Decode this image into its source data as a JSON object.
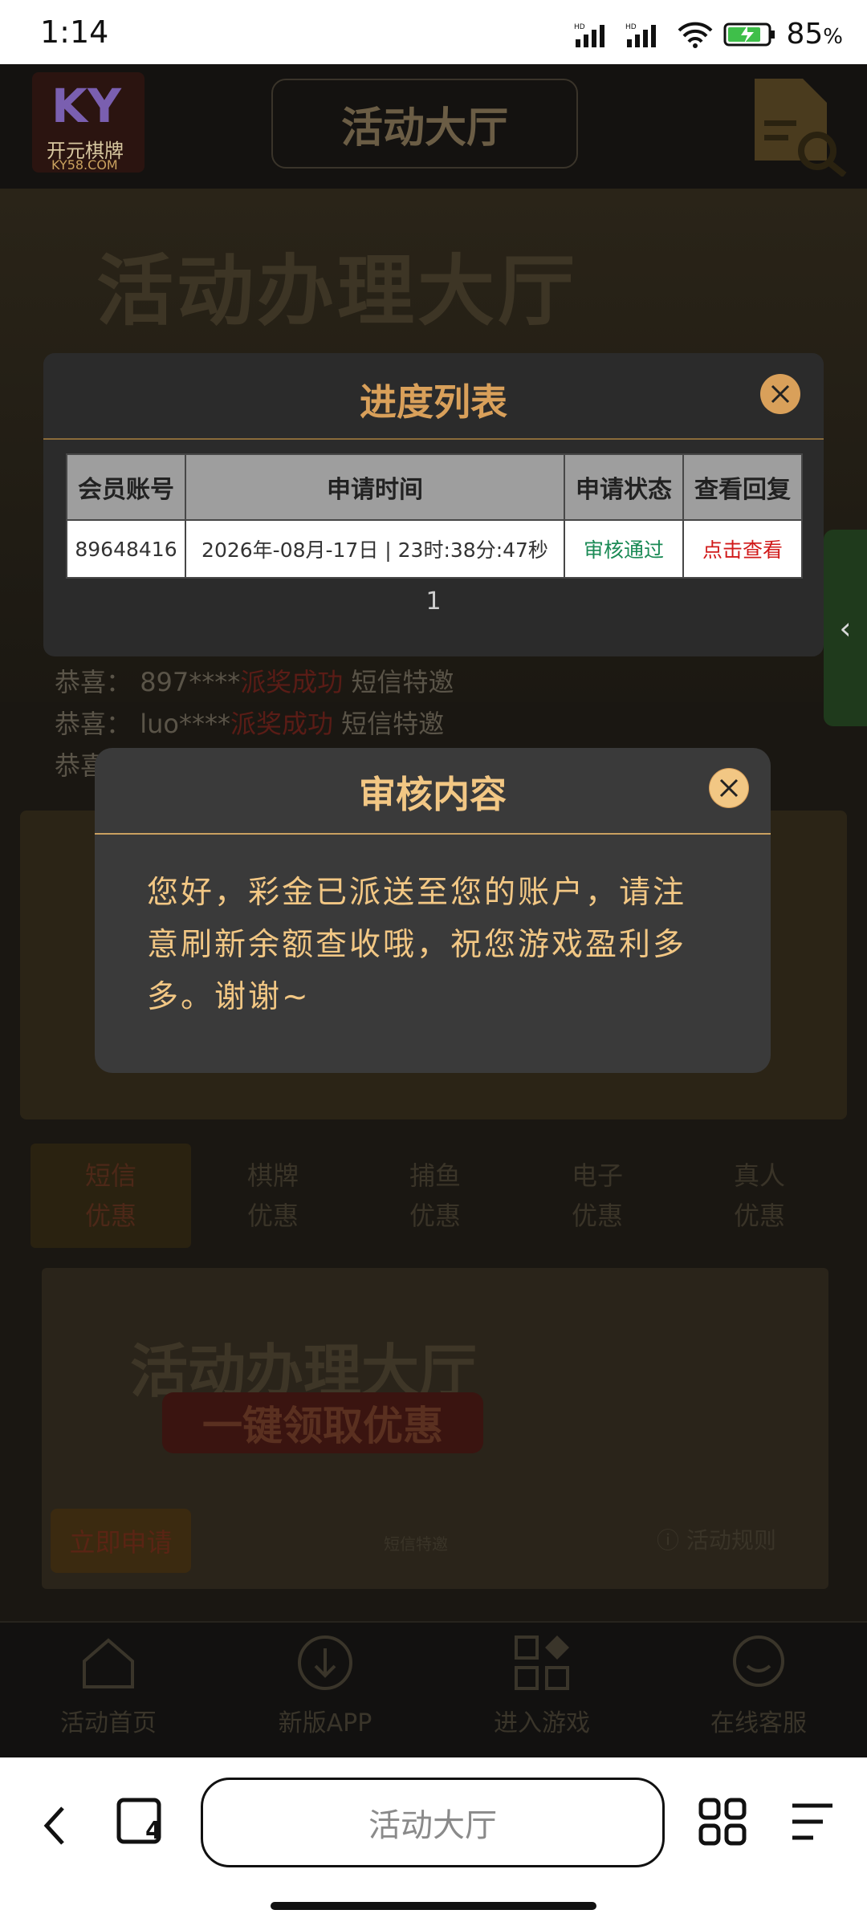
{
  "status_bar": {
    "time": "1:14",
    "battery": "85"
  },
  "header": {
    "title": "活动大厅",
    "logo_letters": "KY",
    "logo_name": "开元棋牌",
    "logo_domain": "KY58.COM"
  },
  "banner": {
    "headline": "活动办理大厅"
  },
  "congrats": [
    {
      "prefix": "恭喜：",
      "user": "897****",
      "prize": "短信特邀"
    },
    {
      "prefix": "恭喜：",
      "user": "luo****",
      "prize": "短信特邀"
    },
    {
      "prefix": "恭喜：",
      "user": "",
      "prize": ""
    }
  ],
  "tabs": [
    {
      "l1": "短信",
      "l2": "优惠"
    },
    {
      "l1": "棋牌",
      "l2": "优惠"
    },
    {
      "l1": "捕鱼",
      "l2": "优惠"
    },
    {
      "l1": "电子",
      "l2": "优惠"
    },
    {
      "l1": "真人",
      "l2": "优惠"
    }
  ],
  "promo_card": {
    "headline": "活动办理大厅",
    "pill": "一键领取优惠",
    "apply": "立即申请",
    "category": "短信特邀",
    "rules": "活动规则"
  },
  "bottom_nav": [
    "活动首页",
    "新版APP",
    "进入游戏",
    "在线客服"
  ],
  "progress_modal": {
    "title": "进度列表",
    "headers": [
      "会员账号",
      "申请时间",
      "申请状态",
      "查看回复"
    ],
    "row": {
      "account": "89648416",
      "time": "2026年-08月-17日 | 23时:38分:47秒",
      "status": "审核通过",
      "reply": "点击查看"
    },
    "page": "1"
  },
  "review_modal": {
    "title": "审核内容",
    "content": "您好，彩金已派送至您的账户，请注意刷新余额查收哦，祝您游戏盈利多多。谢谢~"
  },
  "side_tab": "‹",
  "browser": {
    "url_text": "活动大厅",
    "tab_count": "4"
  }
}
